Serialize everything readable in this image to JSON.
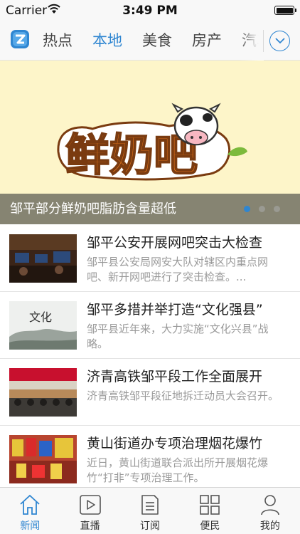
{
  "status_bar": {
    "carrier": "Carrier",
    "time": "3:49 PM"
  },
  "channels": {
    "tabs": [
      "热点",
      "本地",
      "美食",
      "房产",
      "汽车"
    ],
    "active_index": 1,
    "expand_icon": "chevron-down-circle-icon",
    "logo_icon": "app-logo-icon"
  },
  "banner": {
    "caption": "邹平部分鲜奶吧脂肪含量超低",
    "slide_count": 3,
    "active_slide": 1,
    "logo_text": "鲜奶吧"
  },
  "news": [
    {
      "title": "邹平公安开展网吧突击大检查",
      "summary": "邹平县公安局网安大队对辖区内重点网吧、新开网吧进行了突击检查。..."
    },
    {
      "title": "邹平多措并举打造“文化强县”",
      "summary": "邹平县近年来，大力实施“文化兴县”战略。"
    },
    {
      "title": "济青高铁邹平段工作全面展开",
      "summary": "济青高铁邹平段征地拆迁动员大会召开。"
    },
    {
      "title": "黄山街道办专项治理烟花爆竹",
      "summary": "近日，黄山街道联合派出所开展烟花爆竹“打非”专项治理工作。"
    }
  ],
  "tab_bar": {
    "items": [
      {
        "label": "新闻",
        "icon": "home-icon"
      },
      {
        "label": "直播",
        "icon": "play-icon"
      },
      {
        "label": "订阅",
        "icon": "document-icon"
      },
      {
        "label": "便民",
        "icon": "grid-icon"
      },
      {
        "label": "我的",
        "icon": "person-icon"
      }
    ],
    "active_index": 0
  },
  "colors": {
    "accent": "#2f86d1",
    "banner_bg": "#fdf5c9",
    "logo_orange": "#ef7a1a"
  }
}
